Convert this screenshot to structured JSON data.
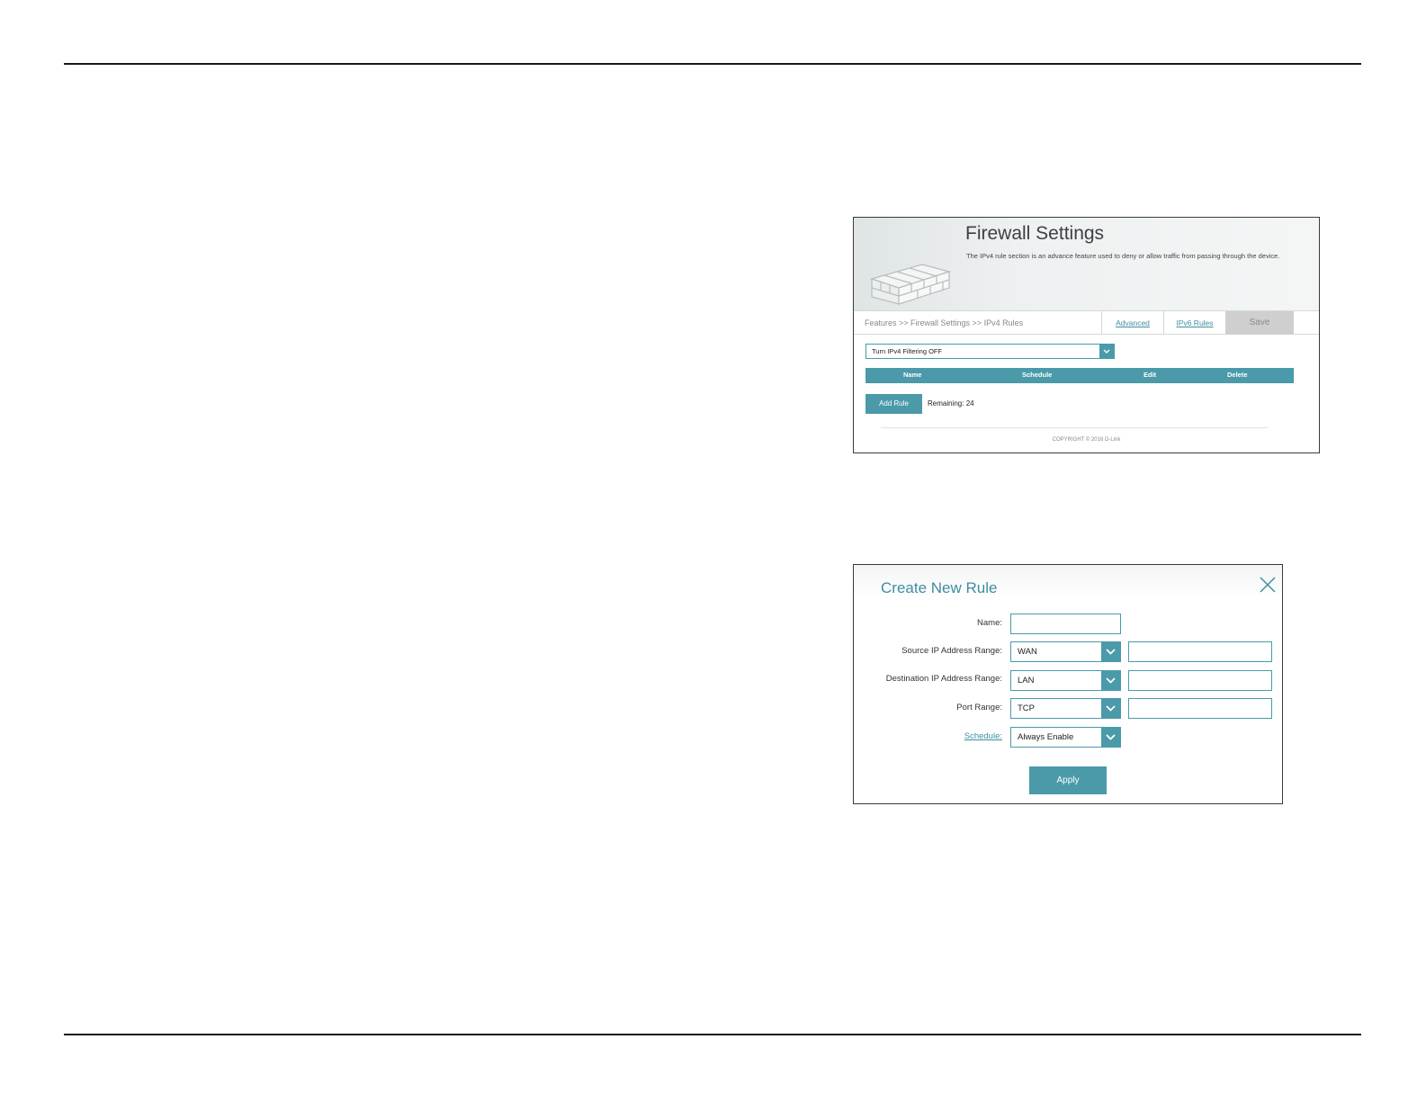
{
  "firewall": {
    "title": "Firewall Settings",
    "description": "The IPv4 rule section is an advance feature used to deny or allow traffic from passing through the device.",
    "breadcrumb": "Features >> Firewall Settings >> IPv4 Rules",
    "tabs": {
      "advanced": "Advanced",
      "ipv6": "IPv6 Rules",
      "save": "Save"
    },
    "filter_select": {
      "selected": "Turn IPv4 Filtering OFF"
    },
    "table_headers": {
      "name": "Name",
      "schedule": "Schedule",
      "edit": "Edit",
      "delete": "Delete"
    },
    "add_rule_label": "Add Rule",
    "remaining_text": "Remaining: 24",
    "copyright": "COPYRIGHT © 2016 D-Link"
  },
  "create_rule": {
    "title": "Create New Rule",
    "labels": {
      "name": "Name:",
      "source": "Source IP Address Range:",
      "destination": "Destination IP Address Range:",
      "port": "Port Range:",
      "schedule": "Schedule:"
    },
    "source_selected": "WAN",
    "destination_selected": "LAN",
    "port_selected": "TCP",
    "schedule_selected": "Always Enable",
    "apply_label": "Apply"
  },
  "icons": {
    "brick_wall": "brick-wall-icon",
    "close": "close-icon",
    "chevron": "chevron-down-icon"
  },
  "colors": {
    "accent": "#4a9aaa",
    "title_accent": "#3f8ea0",
    "save_disabled": "#cfcfcf"
  }
}
